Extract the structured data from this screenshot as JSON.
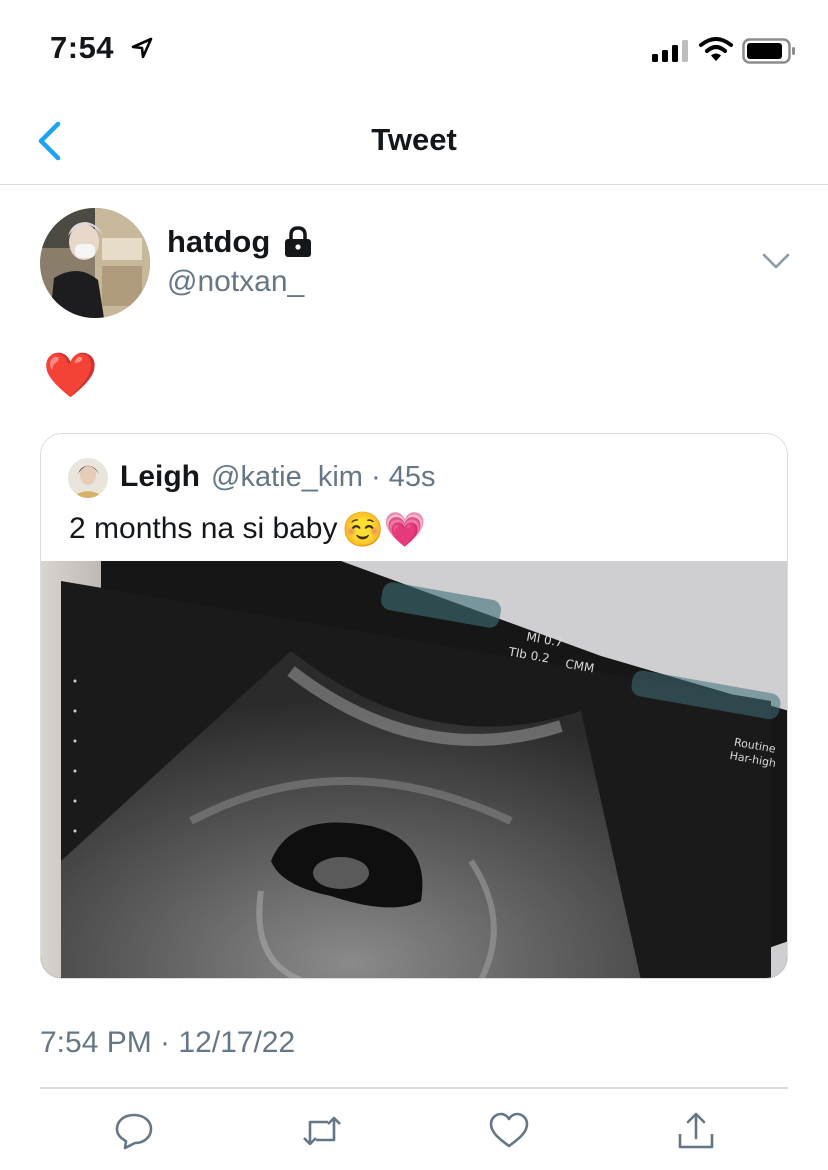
{
  "status_bar": {
    "time": "7:54",
    "icons": [
      "location-arrow-icon",
      "cellular-signal-icon",
      "wifi-icon",
      "battery-icon"
    ]
  },
  "nav": {
    "title": "Tweet",
    "back_icon": "chevron-left-icon"
  },
  "tweet": {
    "author": {
      "display_name": "hatdog",
      "handle": "@notxan_",
      "protected_icon": "lock-icon"
    },
    "text": "❤️",
    "timestamp": "7:54 PM · 12/17/22",
    "menu_icon": "chevron-down-icon"
  },
  "quoted_tweet": {
    "author_name": "Leigh",
    "meta": "@katie_kim · 45s",
    "text": "2 months na si baby",
    "emoji": "☺️💗",
    "media": {
      "type": "ultrasound-photo",
      "overlay_labels": [
        "MI 0.7",
        "TIb 0.2",
        "CMM",
        "Routine",
        "Har-high"
      ]
    }
  },
  "actions": [
    {
      "name": "reply",
      "icon": "reply-icon"
    },
    {
      "name": "retweet",
      "icon": "retweet-icon"
    },
    {
      "name": "like",
      "icon": "heart-icon"
    },
    {
      "name": "share",
      "icon": "share-icon"
    }
  ],
  "colors": {
    "accent": "#1da1f2",
    "secondary_text": "#657786",
    "border": "#d8dde1",
    "text": "#14171a"
  }
}
